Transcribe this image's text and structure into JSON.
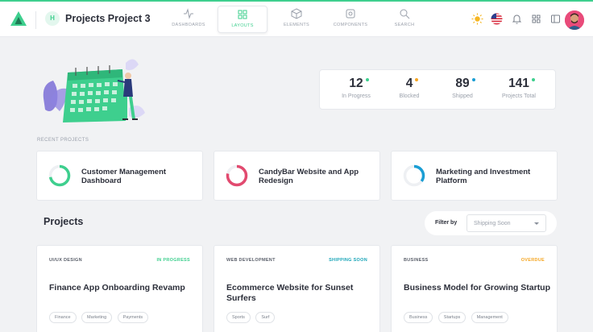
{
  "header": {
    "project_initial": "H",
    "project_title": "Projects Project 3",
    "nav": [
      {
        "label": "DASHBOARDS",
        "icon": "activity-icon",
        "active": false
      },
      {
        "label": "LAYOUTS",
        "icon": "grid-icon",
        "active": true
      },
      {
        "label": "ELEMENTS",
        "icon": "cube-icon",
        "active": false
      },
      {
        "label": "COMPONENTS",
        "icon": "gear-icon",
        "active": false
      },
      {
        "label": "SEARCH",
        "icon": "search-icon",
        "active": false
      }
    ]
  },
  "stats": [
    {
      "value": "12",
      "label": "In Progress",
      "dot_color": "#3ecf8e"
    },
    {
      "value": "4",
      "label": "Blocked",
      "dot_color": "#f5a623"
    },
    {
      "value": "89",
      "label": "Shipped",
      "dot_color": "#1a9ed4"
    },
    {
      "value": "141",
      "label": "Projects Total",
      "dot_color": "#3ecf8e"
    }
  ],
  "recent": {
    "label": "RECENT PROJECTS",
    "items": [
      {
        "title": "Customer Management Dashboard",
        "progress": 0.72,
        "color": "#3ecf8e"
      },
      {
        "title": "CandyBar Website and App Redesign",
        "progress": 0.78,
        "color": "#e24a6f"
      },
      {
        "title": "Marketing and Investment Platform",
        "progress": 0.35,
        "color": "#1a9ed4"
      }
    ]
  },
  "projects": {
    "heading": "Projects",
    "filter_label": "Filter by",
    "filter_value": "Shipping Soon",
    "cards": [
      {
        "category": "UI/UX DESIGN",
        "status": "IN PROGRESS",
        "status_color": "#3ecf8e",
        "title": "Finance App Onboarding Revamp",
        "tags": [
          "Finance",
          "Marketing",
          "Payments"
        ]
      },
      {
        "category": "WEB DEVELOPMENT",
        "status": "SHIPPING SOON",
        "status_color": "#1aa5b8",
        "title": "Ecommerce Website for Sunset Surfers",
        "tags": [
          "Sports",
          "Surf"
        ]
      },
      {
        "category": "BUSINESS",
        "status": "OVERDUE",
        "status_color": "#f5a623",
        "title": "Business Model for Growing Startup",
        "tags": [
          "Business",
          "Startups",
          "Management"
        ]
      }
    ]
  },
  "colors": {
    "accent": "#3ecf8e",
    "background": "#f1f2f4"
  }
}
